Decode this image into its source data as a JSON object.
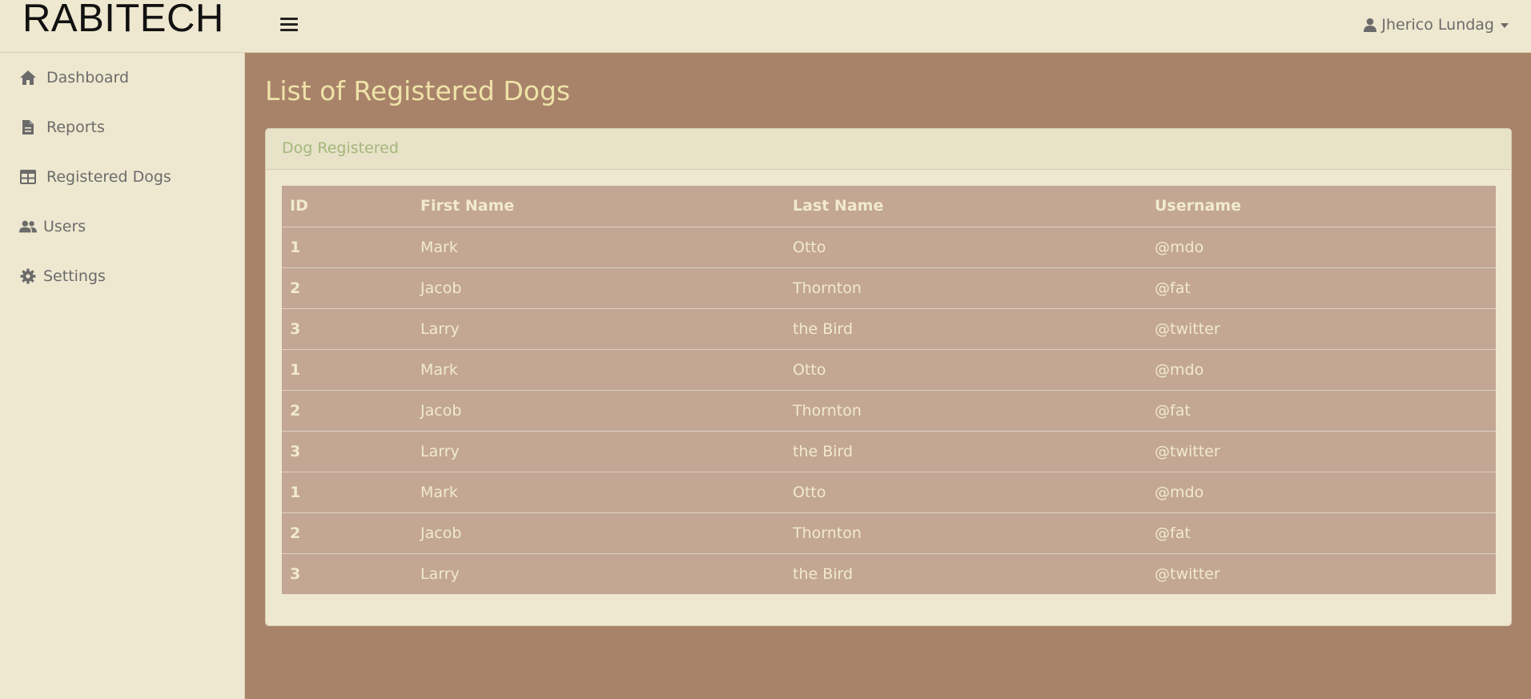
{
  "brand": "RABITECH",
  "user": {
    "name": "Jherico Lundag"
  },
  "sidebar": {
    "items": [
      {
        "label": "Dashboard",
        "icon": "home-icon"
      },
      {
        "label": "Reports",
        "icon": "file-icon"
      },
      {
        "label": "Registered Dogs",
        "icon": "table-icon"
      },
      {
        "label": "Users",
        "icon": "users-icon"
      },
      {
        "label": "Settings",
        "icon": "gear-icon"
      }
    ]
  },
  "main": {
    "title": "List of Registered Dogs",
    "card_title": "Dog Registered",
    "table": {
      "columns": [
        "ID",
        "First Name",
        "Last Name",
        "Username"
      ],
      "rows": [
        [
          "1",
          "Mark",
          "Otto",
          "@mdo"
        ],
        [
          "2",
          "Jacob",
          "Thornton",
          "@fat"
        ],
        [
          "3",
          "Larry",
          "the Bird",
          "@twitter"
        ],
        [
          "1",
          "Mark",
          "Otto",
          "@mdo"
        ],
        [
          "2",
          "Jacob",
          "Thornton",
          "@fat"
        ],
        [
          "3",
          "Larry",
          "the Bird",
          "@twitter"
        ],
        [
          "1",
          "Mark",
          "Otto",
          "@mdo"
        ],
        [
          "2",
          "Jacob",
          "Thornton",
          "@fat"
        ],
        [
          "3",
          "Larry",
          "the Bird",
          "@twitter"
        ]
      ]
    }
  },
  "colors": {
    "sidebar_bg": "#efe8d0",
    "main_bg": "#a8836a",
    "title": "#efe3a8",
    "table_bg": "#c3a694",
    "card_header_text": "#a3b87a"
  }
}
